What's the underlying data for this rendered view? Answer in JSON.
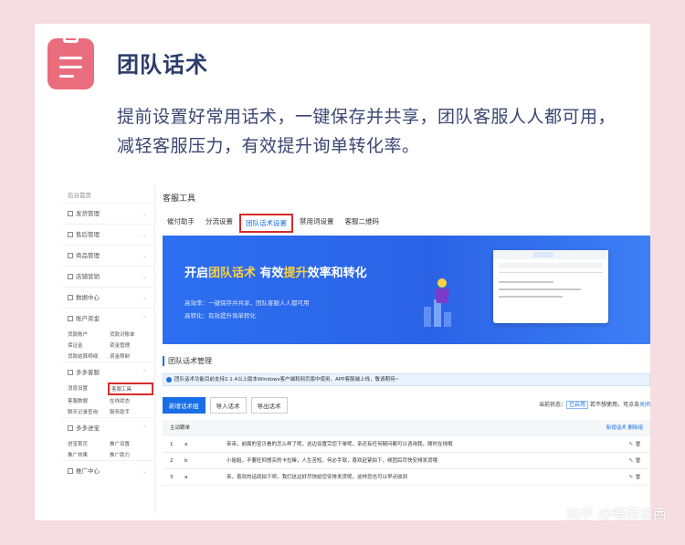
{
  "heading": "团队话术",
  "intro": "提前设置好常用话术，一键保存并共享，团队客服人人都可用，减轻客服压力，有效提升询单转化率。",
  "sidebar": {
    "home": "后台首页",
    "items": [
      {
        "label": "发货管理"
      },
      {
        "label": "售后管理"
      },
      {
        "label": "商品管理"
      },
      {
        "label": "店铺营销"
      },
      {
        "label": "数据中心"
      },
      {
        "label": "账户资金"
      }
    ],
    "account_links": [
      "货款账户",
      "货款对账单",
      "保证金",
      "资金管理",
      "货款结算明细",
      "资金限制"
    ],
    "kefu_section": "多多客服",
    "kefu_links": [
      "消息设置",
      "客服工具",
      "客服数据",
      "在线状态",
      "聊天记录查询",
      "服务助手"
    ],
    "jinbao_section": "多多进宝",
    "jinbao_links": [
      "进宝首页",
      "推广设置",
      "推广效果",
      "推广助力"
    ],
    "promo_section": "推广中心"
  },
  "main": {
    "title": "客服工具",
    "tabs": [
      "催付助手",
      "分流设置",
      "团队话术设置",
      "禁用词设置",
      "客服二维码"
    ],
    "banner_title_a": "开启",
    "banner_title_b": "团队话术",
    "banner_title_c": " 有效",
    "banner_title_d": "提升",
    "banner_title_e": "效率和转化",
    "banner_line1": "高效率：一键保存并共享，团队客服人人都可用",
    "banner_line2": "高转化：有效提升询单转化",
    "section_title": "团队话术管理",
    "notice": "团队话术功能目前支持2.1.4以上版本Windows客户端和网页版中使用，APP客服端上线，敬请期待~",
    "btn_new": "新增话术组",
    "btn_import": "导入话术",
    "btn_export": "导出话术",
    "status_label": "当前状态：",
    "status_tag": "已启用",
    "status_text": "若不想使用，可点击",
    "status_link": "关闭",
    "table_head": "主动跟单",
    "table_add": "新增话术",
    "table_del": "删除组",
    "rows": [
      {
        "n": "1",
        "g": "a",
        "t": "亲亲，前面的宝贝看的怎么样了呢，这边设置完您下单呢，亲还有任何疑问都可以咨询我，随时在线哦"
      },
      {
        "n": "2",
        "g": "b",
        "t": "小姐姐，不要狂抑想买的卡拉嘛，人生苦短，何必手软，喜欢赶紧拍下，候团后尽快安排发货哦"
      },
      {
        "n": "3",
        "g": "a",
        "t": "亲，喜欢的话就拍下呗，我们这边好尽快给您安排发货呢，这样您也可以早点收到"
      }
    ]
  },
  "watermark": "知乎 @晤西迪西"
}
